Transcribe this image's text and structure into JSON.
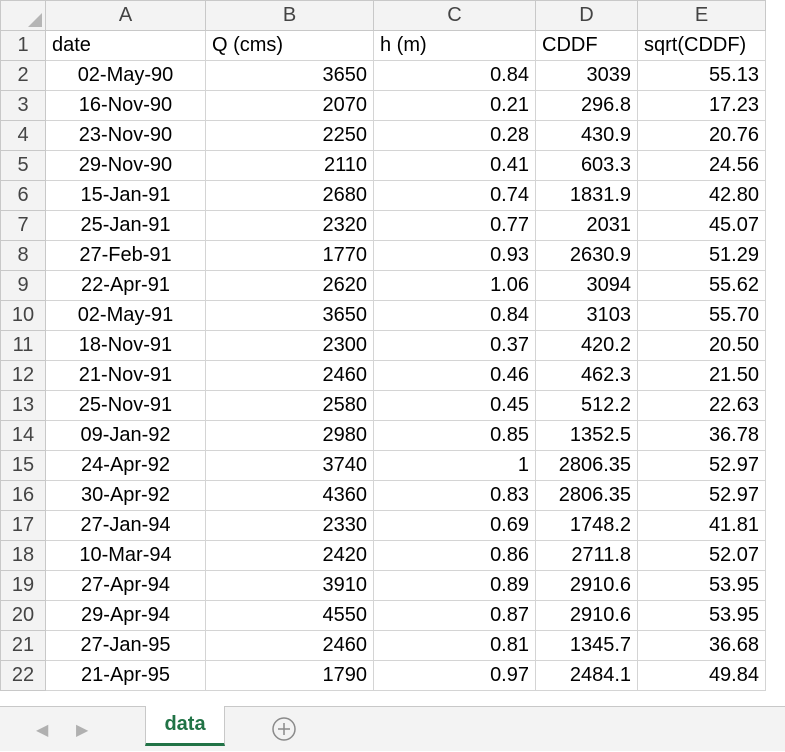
{
  "columns": [
    "A",
    "B",
    "C",
    "D",
    "E"
  ],
  "headers": [
    "date",
    "Q (cms)",
    "h (m)",
    "CDDF",
    "sqrt(CDDF)"
  ],
  "rows": [
    {
      "num": "2",
      "date": "02-May-90",
      "q": "3650",
      "h": "0.84",
      "cddf": "3039",
      "sqrt": "55.13"
    },
    {
      "num": "3",
      "date": "16-Nov-90",
      "q": "2070",
      "h": "0.21",
      "cddf": "296.8",
      "sqrt": "17.23"
    },
    {
      "num": "4",
      "date": "23-Nov-90",
      "q": "2250",
      "h": "0.28",
      "cddf": "430.9",
      "sqrt": "20.76"
    },
    {
      "num": "5",
      "date": "29-Nov-90",
      "q": "2110",
      "h": "0.41",
      "cddf": "603.3",
      "sqrt": "24.56"
    },
    {
      "num": "6",
      "date": "15-Jan-91",
      "q": "2680",
      "h": "0.74",
      "cddf": "1831.9",
      "sqrt": "42.80"
    },
    {
      "num": "7",
      "date": "25-Jan-91",
      "q": "2320",
      "h": "0.77",
      "cddf": "2031",
      "sqrt": "45.07"
    },
    {
      "num": "8",
      "date": "27-Feb-91",
      "q": "1770",
      "h": "0.93",
      "cddf": "2630.9",
      "sqrt": "51.29"
    },
    {
      "num": "9",
      "date": "22-Apr-91",
      "q": "2620",
      "h": "1.06",
      "cddf": "3094",
      "sqrt": "55.62"
    },
    {
      "num": "10",
      "date": "02-May-91",
      "q": "3650",
      "h": "0.84",
      "cddf": "3103",
      "sqrt": "55.70"
    },
    {
      "num": "11",
      "date": "18-Nov-91",
      "q": "2300",
      "h": "0.37",
      "cddf": "420.2",
      "sqrt": "20.50"
    },
    {
      "num": "12",
      "date": "21-Nov-91",
      "q": "2460",
      "h": "0.46",
      "cddf": "462.3",
      "sqrt": "21.50"
    },
    {
      "num": "13",
      "date": "25-Nov-91",
      "q": "2580",
      "h": "0.45",
      "cddf": "512.2",
      "sqrt": "22.63"
    },
    {
      "num": "14",
      "date": "09-Jan-92",
      "q": "2980",
      "h": "0.85",
      "cddf": "1352.5",
      "sqrt": "36.78"
    },
    {
      "num": "15",
      "date": "24-Apr-92",
      "q": "3740",
      "h": "1",
      "cddf": "2806.35",
      "sqrt": "52.97"
    },
    {
      "num": "16",
      "date": "30-Apr-92",
      "q": "4360",
      "h": "0.83",
      "cddf": "2806.35",
      "sqrt": "52.97"
    },
    {
      "num": "17",
      "date": "27-Jan-94",
      "q": "2330",
      "h": "0.69",
      "cddf": "1748.2",
      "sqrt": "41.81"
    },
    {
      "num": "18",
      "date": "10-Mar-94",
      "q": "2420",
      "h": "0.86",
      "cddf": "2711.8",
      "sqrt": "52.07"
    },
    {
      "num": "19",
      "date": "27-Apr-94",
      "q": "3910",
      "h": "0.89",
      "cddf": "2910.6",
      "sqrt": "53.95"
    },
    {
      "num": "20",
      "date": "29-Apr-94",
      "q": "4550",
      "h": "0.87",
      "cddf": "2910.6",
      "sqrt": "53.95"
    },
    {
      "num": "21",
      "date": "27-Jan-95",
      "q": "2460",
      "h": "0.81",
      "cddf": "1345.7",
      "sqrt": "36.68"
    },
    {
      "num": "22",
      "date": "21-Apr-95",
      "q": "1790",
      "h": "0.97",
      "cddf": "2484.1",
      "sqrt": "49.84"
    }
  ],
  "tabs": {
    "prev_icon": "◀",
    "next_icon": "▶",
    "active_sheet": "data",
    "add_icon": "plus-circle-icon"
  },
  "colors": {
    "accent": "#217346",
    "header_bg": "#f3f3f3",
    "gridline": "#d4d4d4"
  }
}
